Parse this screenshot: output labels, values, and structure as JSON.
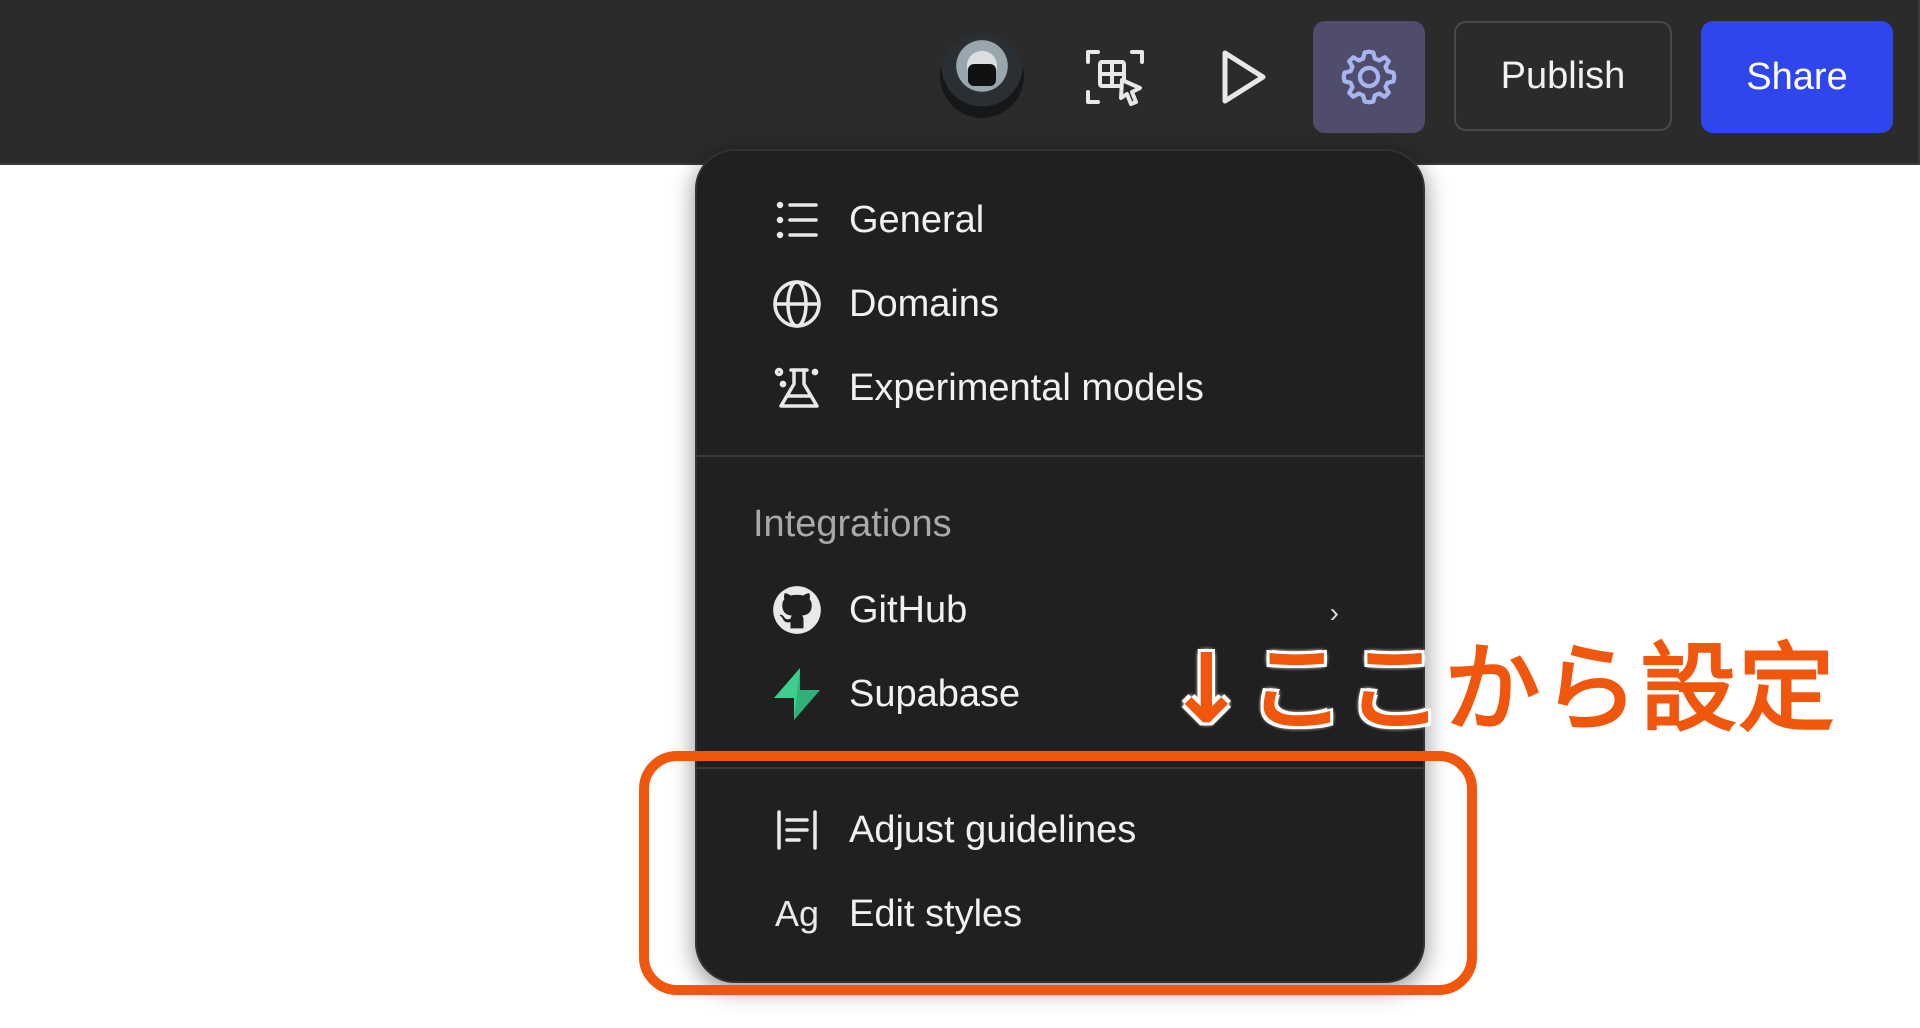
{
  "topbar": {
    "publish_label": "Publish",
    "share_label": "Share",
    "share_color": "#2f45ee",
    "settings_active_bg": "#4f4d6b",
    "icons": {
      "avatar": "avatar",
      "select": "select-frame-icon",
      "play": "play-icon",
      "settings": "gear-icon"
    }
  },
  "menu": {
    "items_top": [
      {
        "label": "General",
        "icon": "list-icon"
      },
      {
        "label": "Domains",
        "icon": "globe-icon"
      },
      {
        "label": "Experimental models",
        "icon": "flask-icon"
      }
    ],
    "integrations_label": "Integrations",
    "integrations": [
      {
        "label": "GitHub",
        "icon": "github-icon",
        "has_submenu": true
      },
      {
        "label": "Supabase",
        "icon": "supabase-icon"
      }
    ],
    "items_bottom": [
      {
        "label": "Adjust guidelines",
        "icon": "guidelines-icon"
      },
      {
        "label": "Edit styles",
        "icon": "typography-icon",
        "icon_text": "Ag"
      }
    ],
    "chevron": "›"
  },
  "annotation": {
    "text": "↓ここから設定",
    "color": "#f1570c"
  }
}
